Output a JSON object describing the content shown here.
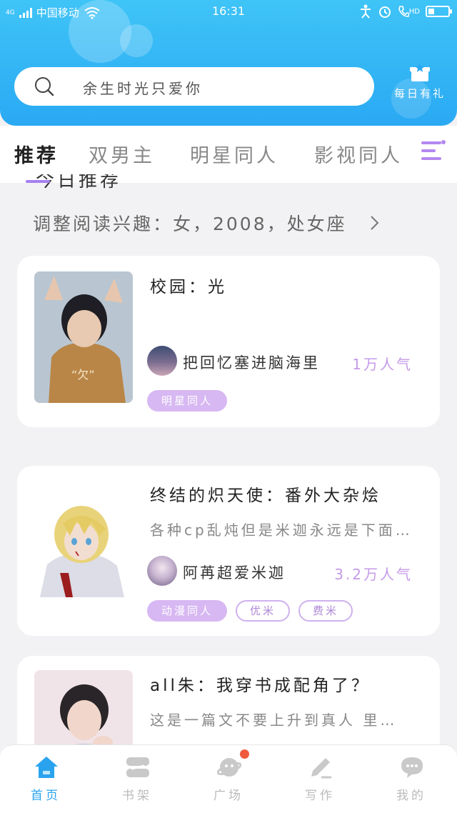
{
  "status_bar": {
    "network": "4G",
    "carrier": "中国移动",
    "time": "16:31",
    "hd": "HD"
  },
  "search": {
    "placeholder": "余生时光只爱你"
  },
  "gift": {
    "label": "每日有礼"
  },
  "tabs": [
    {
      "label": "推荐",
      "active": true
    },
    {
      "label": "双男主",
      "active": false
    },
    {
      "label": "明星同人",
      "active": false
    },
    {
      "label": "影视同人",
      "active": false
    }
  ],
  "section": {
    "title": "今日推荐",
    "interest": "调整阅读兴趣：女，2008，处女座"
  },
  "books": [
    {
      "title": "校园：光",
      "description": "",
      "author": "把回忆塞进脑海里",
      "popularity": "1万人气",
      "tags": [
        {
          "label": "明星同人",
          "style": "filled"
        }
      ]
    },
    {
      "title": "终结的炽天使：番外大杂烩",
      "description": "各种cp乱炖但是米迦永远是下面…",
      "author": "阿苒超爱米迦",
      "popularity": "3.2万人气",
      "tags": [
        {
          "label": "动漫同人",
          "style": "filled"
        },
        {
          "label": "优米",
          "style": "outline"
        },
        {
          "label": "费米",
          "style": "outline"
        }
      ]
    },
    {
      "title": "all朱：我穿书成配角了？",
      "description": "这是一篇文不要上升到真人 里…"
    }
  ],
  "bottom_nav": [
    {
      "label": "首页",
      "icon": "home-icon",
      "active": true
    },
    {
      "label": "书架",
      "icon": "bookshelf-icon",
      "active": false
    },
    {
      "label": "广场",
      "icon": "planet-icon",
      "active": false,
      "badge": true
    },
    {
      "label": "写作",
      "icon": "pen-icon",
      "active": false
    },
    {
      "label": "我的",
      "icon": "chat-icon",
      "active": false
    }
  ],
  "colors": {
    "header": "#2aa9f3",
    "accent": "#a67ff0",
    "tag": "#d7b8f2",
    "nav_active": "#2aa3ef",
    "badge": "#ef5a3c"
  }
}
